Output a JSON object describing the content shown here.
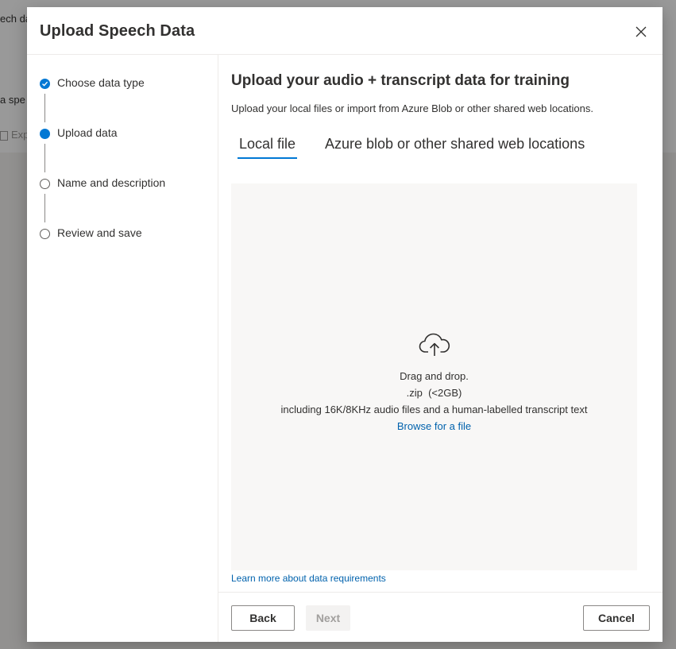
{
  "background": {
    "fragment_title": "ech da",
    "fragment_text": "a spe",
    "fragment_checkbox": "Exp"
  },
  "dialog": {
    "title": "Upload Speech Data",
    "close_icon": "close-icon"
  },
  "steps": [
    {
      "label": "Choose data type",
      "state": "completed"
    },
    {
      "label": "Upload data",
      "state": "current"
    },
    {
      "label": "Name and description",
      "state": "pending"
    },
    {
      "label": "Review and save",
      "state": "pending"
    }
  ],
  "content": {
    "title": "Upload your audio + transcript data for training",
    "subtitle": "Upload your local files or import from Azure Blob or other shared web locations.",
    "tabs": [
      {
        "label": "Local file",
        "active": true
      },
      {
        "label": "Azure blob or other shared web locations",
        "active": false
      }
    ],
    "dropzone": {
      "icon": "cloud-upload-icon",
      "line1": "Drag and drop.",
      "line2": ".zip  (<2GB)",
      "line3": "including 16K/8KHz audio files and a human-labelled transcript text",
      "browse_link": "Browse for a file"
    },
    "learn_more": "Learn more about data requirements"
  },
  "footer": {
    "back_label": "Back",
    "next_label": "Next",
    "cancel_label": "Cancel"
  },
  "colors": {
    "accent": "#0078d4",
    "link": "#0062ad",
    "text": "#323130",
    "dropzone_bg": "#f8f7f6"
  }
}
